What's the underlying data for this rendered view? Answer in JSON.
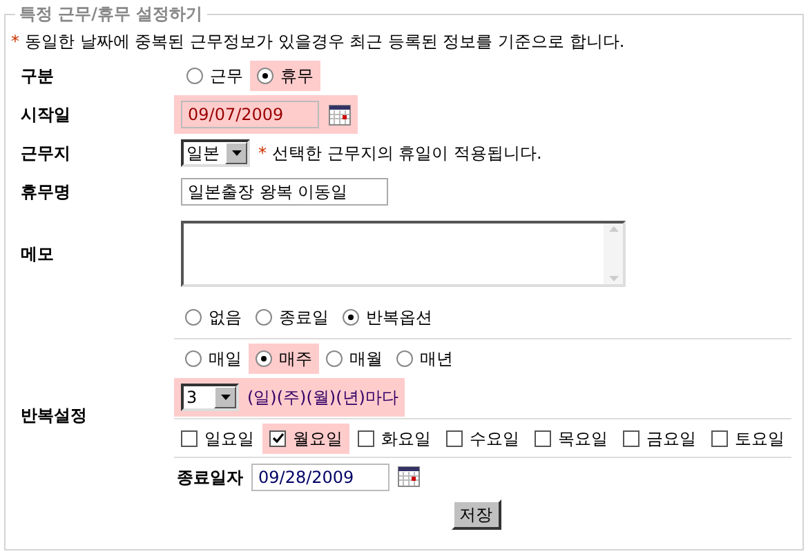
{
  "legend": "특정 근무/휴무 설정하기",
  "notice": {
    "mark": "*",
    "text": "동일한 날짜에 중복된 근무정보가 있을경우 최근 등록된 정보를 기준으로 합니다."
  },
  "type": {
    "label": "구분",
    "options": [
      {
        "label": "근무",
        "selected": false
      },
      {
        "label": "휴무",
        "selected": true
      }
    ]
  },
  "start_date": {
    "label": "시작일",
    "value": "09/07/2009",
    "highlighted": true
  },
  "location": {
    "label": "근무지",
    "value": "일본",
    "note_mark": "*",
    "note": "선택한 근무지의 휴일이 적용됩니다."
  },
  "holiday_name": {
    "label": "휴무명",
    "value": "일본출장 왕복 이동일"
  },
  "memo": {
    "label": "메모"
  },
  "repeat": {
    "label": "반복설정",
    "end_options": [
      {
        "label": "없음",
        "selected": false
      },
      {
        "label": "종료일",
        "selected": false
      },
      {
        "label": "반복옵션",
        "selected": true
      }
    ],
    "frequency": [
      {
        "label": "매일",
        "selected": false
      },
      {
        "label": "매주",
        "selected": true
      },
      {
        "label": "매월",
        "selected": false
      },
      {
        "label": "매년",
        "selected": false
      }
    ],
    "count": {
      "value": "3",
      "suffix": "(일)(주)(월)(년)마다",
      "highlighted": true
    },
    "days": [
      {
        "label": "일요일",
        "checked": false
      },
      {
        "label": "월요일",
        "checked": true
      },
      {
        "label": "화요일",
        "checked": false
      },
      {
        "label": "수요일",
        "checked": false
      },
      {
        "label": "목요일",
        "checked": false
      },
      {
        "label": "금요일",
        "checked": false
      },
      {
        "label": "토요일",
        "checked": false
      }
    ],
    "end_date": {
      "label": "종료일자",
      "value": "09/28/2009"
    }
  },
  "save_button": "저장"
}
